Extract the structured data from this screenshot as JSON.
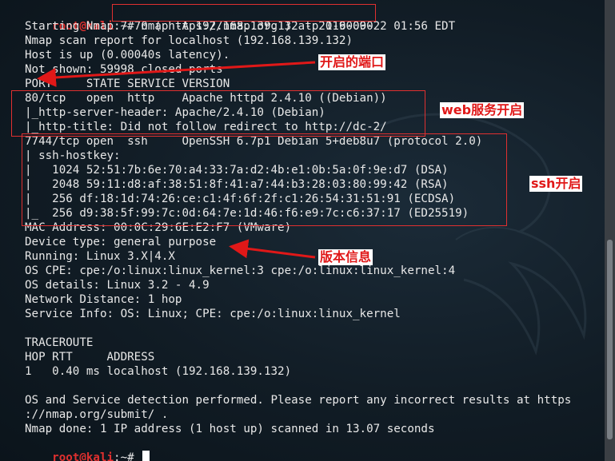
{
  "terminal": {
    "prompt_user": "root@kali",
    "prompt_path": ":~",
    "prompt_symbol": "# ",
    "command": "nmap -A 192.168.139.132 -p 1-60000",
    "output": [
      "Starting Nmap 7.70 ( https://nmap.org ) at 2019-09-22 01:56 EDT",
      "Nmap scan report for localhost (192.168.139.132)",
      "Host is up (0.00040s latency).",
      "Not shown: 59998 closed ports",
      "PORT     STATE SERVICE VERSION",
      "80/tcp   open  http    Apache httpd 2.4.10 ((Debian))",
      "|_http-server-header: Apache/2.4.10 (Debian)",
      "|_http-title: Did not follow redirect to http://dc-2/",
      "7744/tcp open  ssh     OpenSSH 6.7p1 Debian 5+deb8u7 (protocol 2.0)",
      "| ssh-hostkey:",
      "|   1024 52:51:7b:6e:70:a4:33:7a:d2:4b:e1:0b:5a:0f:9e:d7 (DSA)",
      "|   2048 59:11:d8:af:38:51:8f:41:a7:44:b3:28:03:80:99:42 (RSA)",
      "|   256 df:18:1d:74:26:ce:c1:4f:6f:2f:c1:26:54:31:51:91 (ECDSA)",
      "|_  256 d9:38:5f:99:7c:0d:64:7e:1d:46:f6:e9:7c:c6:37:17 (ED25519)",
      "MAC Address: 00:0C:29:6E:E2:F7 (VMware)",
      "Device type: general purpose",
      "Running: Linux 3.X|4.X",
      "OS CPE: cpe:/o:linux:linux_kernel:3 cpe:/o:linux:linux_kernel:4",
      "OS details: Linux 3.2 - 4.9",
      "Network Distance: 1 hop",
      "Service Info: OS: Linux; CPE: cpe:/o:linux:linux_kernel",
      "",
      "TRACEROUTE",
      "HOP RTT     ADDRESS",
      "1   0.40 ms localhost (192.168.139.132)",
      "",
      "OS and Service detection performed. Please report any incorrect results at https",
      "://nmap.org/submit/ .",
      "Nmap done: 1 IP address (1 host up) scanned in 13.07 seconds"
    ]
  },
  "annotations": {
    "open_ports": "开启的端口",
    "web_open": "web服务开启",
    "ssh_open": "ssh开启",
    "version_info": "版本信息"
  },
  "colors": {
    "annotation_red": "#e01818",
    "prompt_red": "#e0302f",
    "background": "#111c25"
  }
}
